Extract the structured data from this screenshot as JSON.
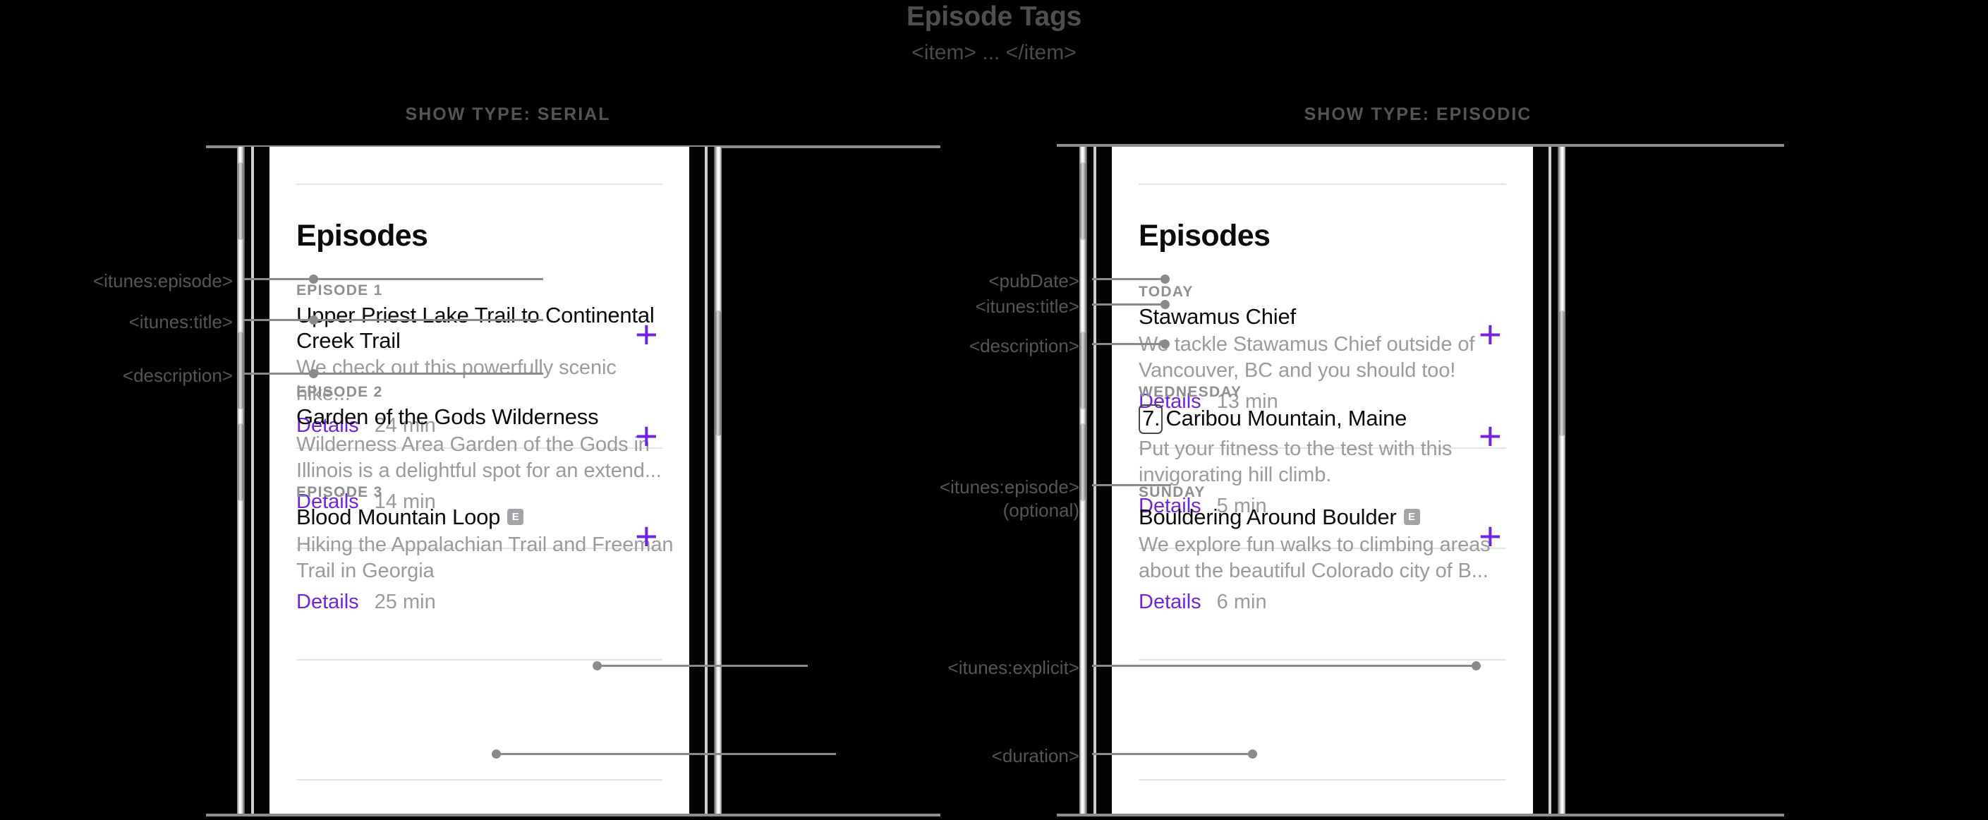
{
  "header": {
    "title": "Episode Tags",
    "subtitle": "<item> ... </item>"
  },
  "columns": [
    {
      "heading": "SHOW TYPE: SERIAL"
    },
    {
      "heading": "SHOW TYPE: EPISODIC"
    }
  ],
  "colors": {
    "accent_purple": "#7124e0",
    "background": "#000000",
    "screen": "#ffffff",
    "muted_text": "#9a9a9f",
    "annotation_text": "#565656",
    "annotation_line": "#8a8a8a",
    "explicit_badge": "#a3a3a8"
  },
  "serial_phone": {
    "screen_title": "Episodes",
    "add_label": "+",
    "episodes": [
      {
        "kicker": "EPISODE 1",
        "title": "Upper Priest Lake Trail to Continental Creek Trail",
        "description": "We check out this powerfully scenic hike...",
        "details_label": "Details",
        "duration": "24 min",
        "explicit": false
      },
      {
        "kicker": "EPISODE 2",
        "title": "Garden of the Gods Wilderness",
        "description": "Wilderness Area Garden of the Gods in Illinois is a delightful spot for an extend...",
        "details_label": "Details",
        "duration": "14 min",
        "explicit": false
      },
      {
        "kicker": "EPISODE 3",
        "title": "Blood Mountain Loop",
        "description": "Hiking the Appalachian Trail and Freeman Trail in Georgia",
        "details_label": "Details",
        "duration": "25 min",
        "explicit": true,
        "explicit_badge": "E"
      }
    ]
  },
  "episodic_phone": {
    "screen_title": "Episodes",
    "add_label": "+",
    "episodes": [
      {
        "kicker": "TODAY",
        "title": "Stawamus Chief",
        "description": "We tackle Stawamus Chief outside of Vancouver, BC and you should too!",
        "details_label": "Details",
        "duration": "13 min",
        "explicit": false
      },
      {
        "kicker": "WEDNESDAY",
        "episode_number": "7.",
        "title": "Caribou Mountain, Maine",
        "description": "Put your fitness to the test with this invigorating hill climb.",
        "details_label": "Details",
        "duration": "5 min",
        "explicit": false
      },
      {
        "kicker": "SUNDAY",
        "title": "Bouldering Around Boulder",
        "description": "We explore fun walks to climbing areas about the beautiful Colorado city of B...",
        "details_label": "Details",
        "duration": "6 min",
        "explicit": true,
        "explicit_badge": "E"
      }
    ]
  },
  "annotations": {
    "left": [
      {
        "label": "<itunes:episode>"
      },
      {
        "label": "<itunes:title>"
      },
      {
        "label": "<description>"
      }
    ],
    "middle": [
      {
        "label": "<pubDate>"
      },
      {
        "label": "<itunes:title>"
      },
      {
        "label": "<description>"
      },
      {
        "label": "<itunes:episode>\n(optional)"
      },
      {
        "label": "<itunes:explicit>"
      },
      {
        "label": "<duration>"
      }
    ]
  }
}
